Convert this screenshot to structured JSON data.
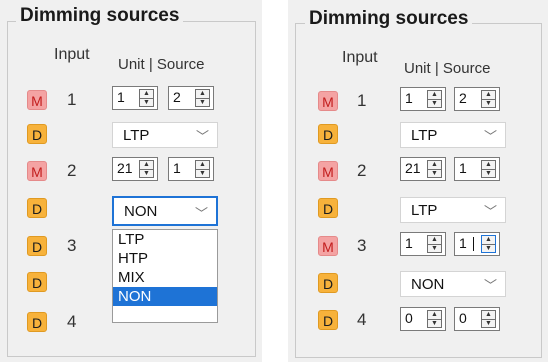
{
  "panel_left": {
    "legend": "Dimming sources",
    "header_input": "Input",
    "header_unit_source": "Unit | Source",
    "m_label": "M",
    "d_label": "D",
    "inputs": [
      "1",
      "2",
      "3",
      "4"
    ],
    "row1": {
      "unit": "1",
      "source": "2"
    },
    "row1_mode": "LTP",
    "row2": {
      "unit": "21",
      "source": "1"
    },
    "row2_mode": "NON",
    "dropdown_options": [
      "LTP",
      "HTP",
      "MIX",
      "NON"
    ],
    "dropdown_selected": "NON"
  },
  "panel_right": {
    "legend": "Dimming sources",
    "header_input": "Input",
    "header_unit_source": "Unit | Source",
    "m_label": "M",
    "d_label": "D",
    "inputs": [
      "1",
      "2",
      "3",
      "4"
    ],
    "row1": {
      "unit": "1",
      "source": "2"
    },
    "row1_mode": "LTP",
    "row2": {
      "unit": "21",
      "source": "1"
    },
    "row2_mode_a": "LTP",
    "row3": {
      "unit": "1",
      "source": "1"
    },
    "row3_mode": "NON",
    "row4": {
      "unit": "0",
      "source": "0"
    }
  },
  "colors": {
    "m_button": "#f4a3a3",
    "d_button": "#f7b23b",
    "focus_blue": "#1e73d6"
  },
  "icons": {
    "spinner": "up-down-arrows-icon",
    "dropdown": "chevron-down-icon"
  }
}
